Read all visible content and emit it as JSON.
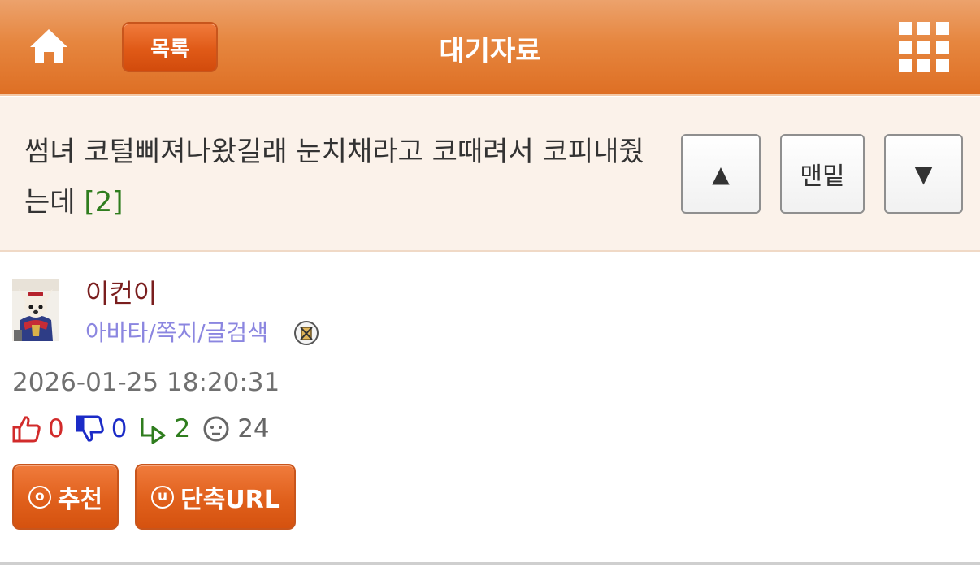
{
  "header": {
    "home_icon": "home-icon",
    "list_label": "목록",
    "title": "대기자료",
    "menu_icon": "grid-menu-icon"
  },
  "post": {
    "title": "썸녀 코털삐져나왔길래 눈치채라고 코때려서 코피내줬는데",
    "comment_count": "[2]",
    "nav": {
      "up_label": "▲",
      "bottom_label": "맨밑",
      "down_label": "▼"
    },
    "author": {
      "name": "이컨이",
      "links": "아바타/쪽지/글검색",
      "avatar_icon": "dog-avatar"
    },
    "date": "2026-01-25 18:20:31",
    "stats": {
      "up": "0",
      "down": "0",
      "replies": "2",
      "views": "24"
    },
    "actions": {
      "recommend_label": "추천",
      "recommend_icon_char": "o",
      "shorturl_label": "단축URL",
      "shorturl_icon_char": "u"
    }
  },
  "colors": {
    "header_orange": "#e6863f",
    "button_orange": "#e0601c",
    "title_bg": "#fbf2ea",
    "author_name": "#7a1e1e",
    "author_links": "#8b86e0",
    "up_red": "#d22b2b",
    "down_blue": "#1b2bc7",
    "reply_green": "#2f7d1e"
  }
}
